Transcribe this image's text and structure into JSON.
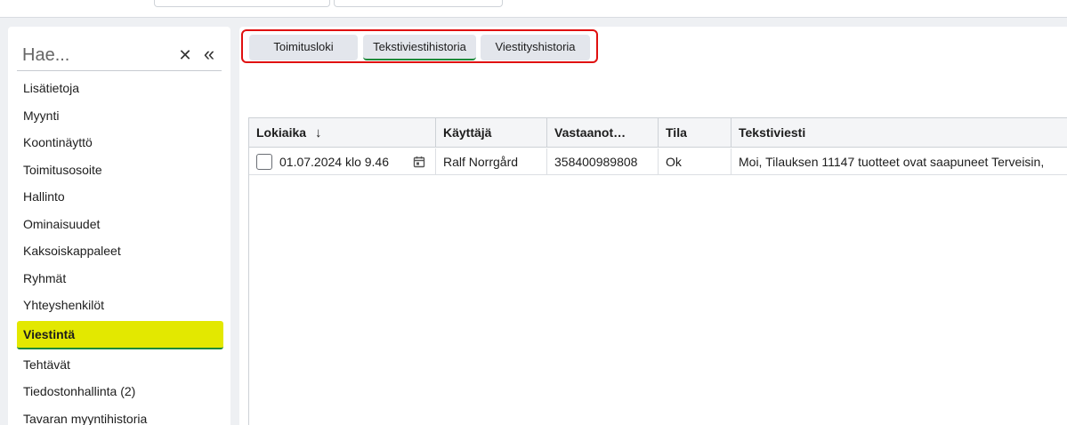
{
  "sidebar": {
    "search_placeholder": "Hae...",
    "clear_icon": "✕",
    "collapse_icon": "«",
    "items": [
      {
        "label": "Lisätietoja"
      },
      {
        "label": "Myynti"
      },
      {
        "label": "Koontinäyttö"
      },
      {
        "label": "Toimitusosoite"
      },
      {
        "label": "Hallinto"
      },
      {
        "label": "Ominaisuudet"
      },
      {
        "label": "Kaksoiskappaleet"
      },
      {
        "label": "Ryhmät"
      },
      {
        "label": "Yhteyshenkilöt"
      },
      {
        "label": "Viestintä",
        "active": true
      },
      {
        "label": "Tehtävät"
      },
      {
        "label": "Tiedostonhallinta (2)"
      },
      {
        "label": "Tavaran myyntihistoria"
      }
    ]
  },
  "tabs": [
    {
      "label": "Toimitusloki"
    },
    {
      "label": "Tekstiviestihistoria",
      "active": true
    },
    {
      "label": "Viestityshistoria"
    }
  ],
  "table": {
    "columns": [
      "Lokiaika",
      "Käyttäjä",
      "Vastaanot…",
      "Tila",
      "Tekstiviesti"
    ],
    "sort_icon": "↓",
    "rows": [
      {
        "date": "01.07.2024 klo 9.46",
        "user": "Ralf Norrgård",
        "recipient": "358400989808",
        "status": "Ok",
        "message": "Moi, Tilauksen 11147 tuotteet ovat saapuneet Terveisin,"
      }
    ]
  },
  "colors": {
    "active_nav_bg": "#e3e800",
    "active_underline": "#1d8a3a",
    "highlight_border": "#e01010"
  }
}
